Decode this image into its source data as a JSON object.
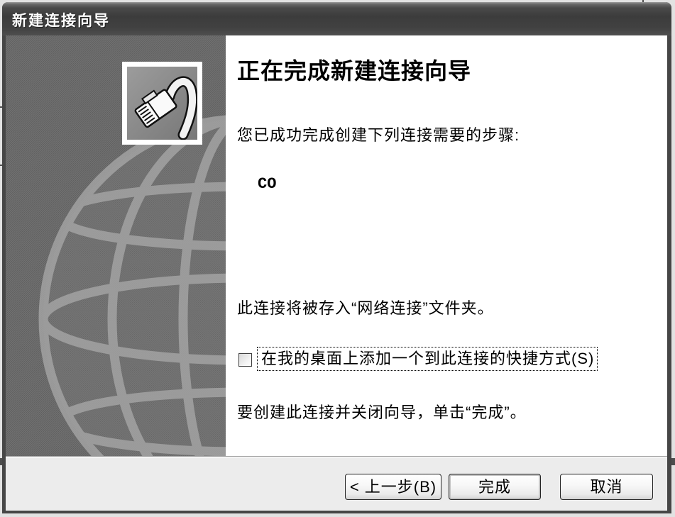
{
  "window": {
    "title": "新建连接向导"
  },
  "watermark": {
    "icon": "network-cable-plug-icon",
    "background_icon": "globe-icon"
  },
  "page": {
    "heading": "正在完成新建连接向导",
    "intro": "您已成功完成创建下列连接需要的步骤:",
    "connection_name": "CO",
    "storage_note": "此连接将被存入“网络连接”文件夹。",
    "shortcut_option": {
      "label": "在我的桌面上添加一个到此连接的快捷方式(S)",
      "checked": false
    },
    "finish_hint": "要创建此连接并关闭向导，单击“完成”。"
  },
  "buttons": {
    "back": "< 上一步(B)",
    "finish": "完成",
    "cancel": "取消"
  },
  "colors": {
    "title_bar": "#3c3c3c",
    "side_panel": "#6c6c6c",
    "content": "#ffffff",
    "button_bar": "#ececec"
  }
}
